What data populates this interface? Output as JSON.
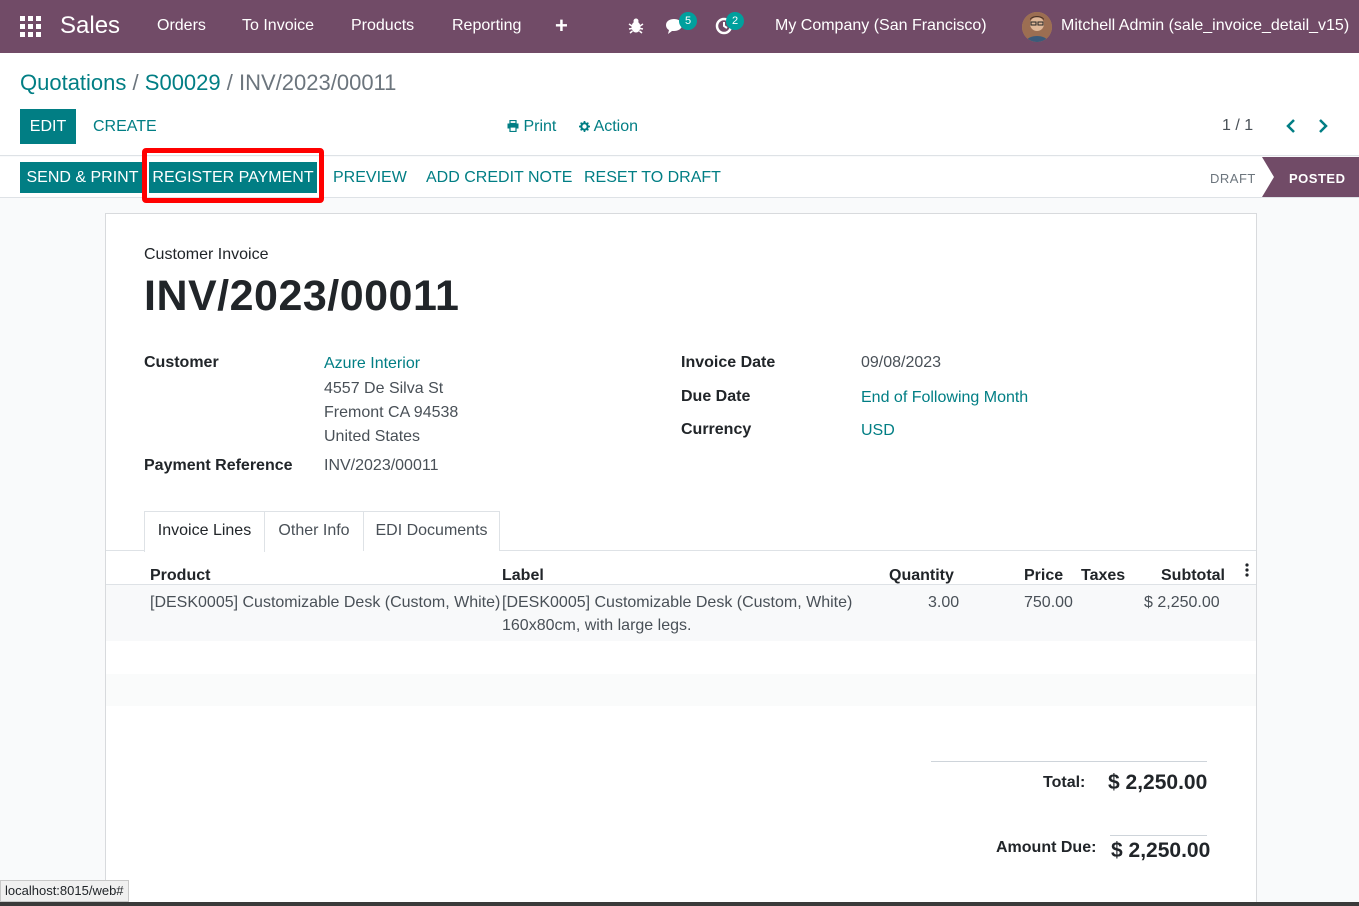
{
  "navbar": {
    "app_name": "Sales",
    "menu": [
      "Orders",
      "To Invoice",
      "Products",
      "Reporting"
    ],
    "plus_label": "+",
    "messages_badge": "5",
    "activities_badge": "2",
    "company": "My Company (San Francisco)",
    "user": "Mitchell Admin (sale_invoice_detail_v15)"
  },
  "breadcrumb": {
    "first": "Quotations",
    "second": "S00029",
    "current": "INV/2023/00011",
    "sep": "/"
  },
  "control": {
    "edit_label": "EDIT",
    "create_label": "CREATE",
    "print_label": "Print",
    "action_label": "Action",
    "pager": "1 / 1"
  },
  "statusbar": {
    "send_print": "SEND & PRINT",
    "register_payment": "REGISTER PAYMENT",
    "preview": "PREVIEW",
    "add_credit_note": "ADD CREDIT NOTE",
    "reset_to_draft": "RESET TO DRAFT",
    "stage_draft": "DRAFT",
    "stage_posted": "POSTED"
  },
  "invoice": {
    "type": "Customer Invoice",
    "number": "INV/2023/00011",
    "customer_label": "Customer",
    "customer_name": "Azure Interior",
    "address_line1": "4557 De Silva St",
    "address_line2": "Fremont CA 94538",
    "address_line3": "United States",
    "payment_ref_label": "Payment Reference",
    "payment_ref": "INV/2023/00011",
    "invoice_date_label": "Invoice Date",
    "invoice_date": "09/08/2023",
    "due_date_label": "Due Date",
    "due_date": "End of Following Month",
    "currency_label": "Currency",
    "currency": "USD"
  },
  "tabs": [
    "Invoice Lines",
    "Other Info",
    "EDI Documents"
  ],
  "table": {
    "headers": [
      "Product",
      "Label",
      "Quantity",
      "Price",
      "Taxes",
      "Subtotal"
    ],
    "rows": [
      {
        "product": "[DESK0005] Customizable Desk (Custom, White)",
        "label_line1": "[DESK0005] Customizable Desk (Custom, White)",
        "label_line2": "160x80cm, with large legs.",
        "quantity": "3.00",
        "price": "750.00",
        "taxes": "",
        "subtotal": "$ 2,250.00"
      }
    ]
  },
  "totals": {
    "total_label": "Total:",
    "total_value": "$ 2,250.00",
    "amount_due_label": "Amount Due:",
    "amount_due_value": "$ 2,250.00"
  },
  "browser_status": "localhost:8015/web#",
  "colors": {
    "brand": "#714b67",
    "primary": "#017e84",
    "badge": "#00a09d",
    "highlight": "#ff0000"
  }
}
